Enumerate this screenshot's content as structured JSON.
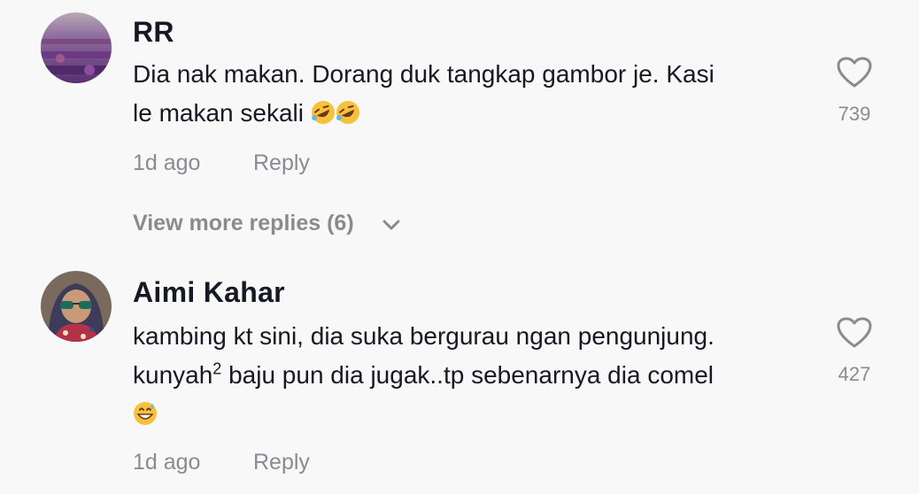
{
  "comments": [
    {
      "username": "RR",
      "text_line1": "Dia nak makan. Dorang duk tangkap gambor je. Kasi",
      "text_line2": "le makan sekali",
      "emoji": "rolling-on-floor-laughing x2",
      "time": "1d ago",
      "reply_label": "Reply",
      "likes": "739"
    },
    {
      "username": "Aimi Kahar",
      "text_line1": "kambing kt sini, dia suka bergurau ngan pengunjung.",
      "text_line2a": "kunyah",
      "text_line2_sup": "2",
      "text_line2b": " baju pun dia jugak..tp sebenarnya dia comel",
      "emoji": "grinning-face-with-sweat",
      "time": "1d ago",
      "reply_label": "Reply",
      "likes": "427"
    }
  ],
  "view_more_label": "View more replies (6)",
  "colors": {
    "background": "#f8f8f8",
    "text_primary": "#161823",
    "text_secondary": "#8a8b91"
  },
  "icons": [
    "heart-icon",
    "chevron-down-icon"
  ]
}
